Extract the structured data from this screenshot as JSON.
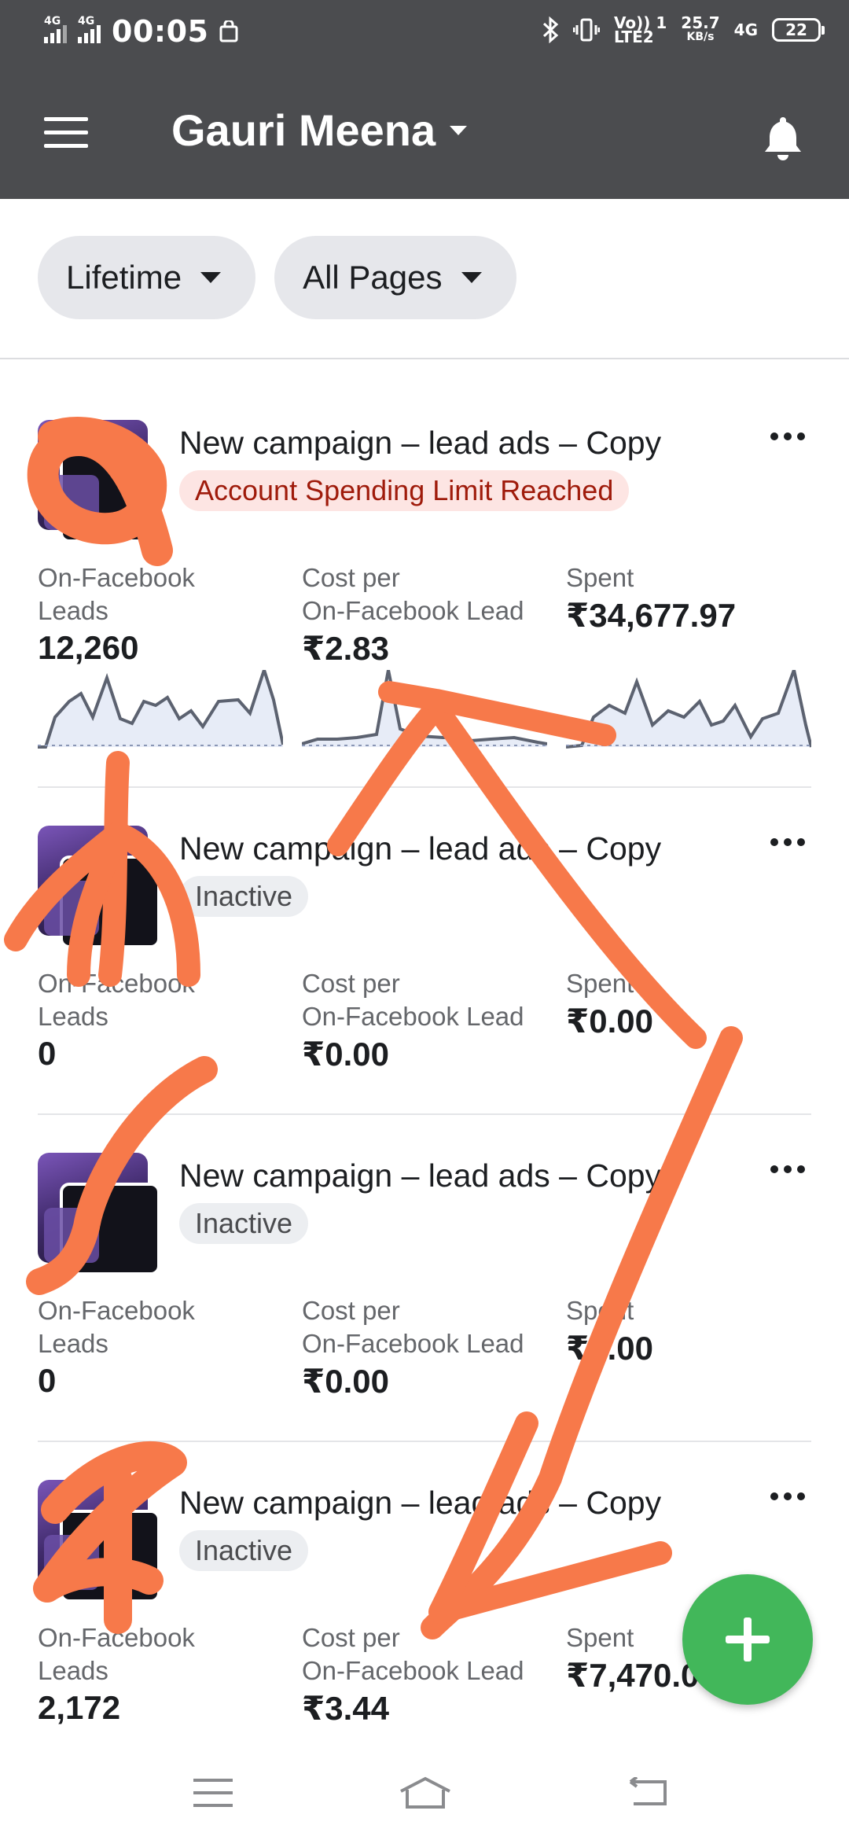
{
  "status": {
    "time": "00:05",
    "net1": "4G",
    "net2": "4G",
    "volte": "Vo)) 1",
    "lte": "LTE2",
    "speed": "25.7",
    "speed_unit": "KB/s",
    "net3": "4G",
    "battery": "22"
  },
  "appbar": {
    "title": "Gauri Meena",
    "icons": [
      "menu-icon",
      "chevron-down-icon",
      "bell-icon"
    ]
  },
  "filters": {
    "range": "Lifetime",
    "pages": "All Pages"
  },
  "labels": {
    "leads_line1": "On-Facebook",
    "leads_line2": "Leads",
    "cost_line1": "Cost per",
    "cost_line2": "On-Facebook Lead",
    "spent": "Spent"
  },
  "campaigns": [
    {
      "title": "New campaign – lead ads – Copy",
      "status": "Account Spending Limit Reached",
      "status_type": "error",
      "leads": "12,260",
      "cost": "₹2.83",
      "spent": "₹34,677.97"
    },
    {
      "title": "New campaign – lead ads – Copy",
      "status": "Inactive",
      "status_type": "inactive",
      "leads": "0",
      "cost": "₹0.00",
      "spent": "₹0.00"
    },
    {
      "title": "New campaign – lead ads – Copy",
      "status": "Inactive",
      "status_type": "inactive",
      "leads": "0",
      "cost": "₹0.00",
      "spent": "₹0.00"
    },
    {
      "title": "New campaign – lead ads – Copy",
      "status": "Inactive",
      "status_type": "inactive",
      "leads": "2,172",
      "cost": "₹3.44",
      "spent": "₹7,470.0"
    }
  ],
  "colors": {
    "appbar": "#4b4c4f",
    "fab": "#42b75a",
    "error_badge_bg": "#fde5e3",
    "error_badge_text": "#9f1b0b",
    "spark_line": "#5c6270",
    "spark_fill": "#e7ecf7",
    "annotation": "#f7794a"
  }
}
